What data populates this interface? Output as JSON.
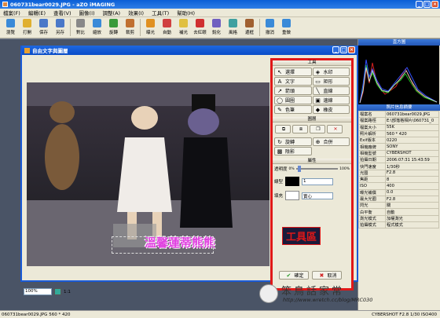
{
  "window": {
    "title": "060731bear0029.JPG - aZO iMAGING"
  },
  "menu": [
    "檔案(F)",
    "編輯(E)",
    "查看(V)",
    "圖像(I)",
    "調整(A)",
    "效果(I)",
    "工具(T)",
    "幫助(H)"
  ],
  "toolbar": [
    {
      "label": "瀏覽",
      "icon": "browse-icon"
    },
    {
      "label": "打開",
      "icon": "open-icon"
    },
    {
      "label": "保存",
      "icon": "save-icon"
    },
    {
      "label": "另存",
      "icon": "save-as-icon"
    },
    {
      "label": "對比",
      "icon": "compare-icon"
    },
    {
      "label": "縮放",
      "icon": "zoom-icon"
    },
    {
      "label": "旋轉",
      "icon": "rotate-icon"
    },
    {
      "label": "裁剪",
      "icon": "crop-icon"
    },
    {
      "label": "曝光",
      "icon": "exposure-icon"
    },
    {
      "label": "自動",
      "icon": "auto-icon"
    },
    {
      "label": "補光",
      "icon": "fill-light-icon"
    },
    {
      "label": "去紅眼",
      "icon": "red-eye-icon"
    },
    {
      "label": "銳化",
      "icon": "sharpen-icon"
    },
    {
      "label": "風格",
      "icon": "style-icon"
    },
    {
      "label": "邊框",
      "icon": "frame-icon"
    },
    {
      "label": "撤消",
      "icon": "undo-icon"
    },
    {
      "label": "重做",
      "icon": "redo-icon"
    }
  ],
  "histogram_panel": {
    "title": "直方圖"
  },
  "exif_panel": {
    "title": "照片信息摘要",
    "rows": [
      [
        "檔案名",
        "060731bear0029.JPG"
      ],
      [
        "檔案路徑",
        "E:\\部落格相片\\060731_0"
      ],
      [
        "檔案大小",
        "55K"
      ],
      [
        "照片解析",
        "560 * 420"
      ],
      [
        "Exif版本",
        "0220"
      ],
      [
        "相機廠牌",
        "SONY"
      ],
      [
        "相機型號",
        "CYBERSHOT"
      ],
      [
        "拍攝日期",
        "2006:07:31 15:43:59"
      ],
      [
        "快門速度",
        "1/30秒"
      ],
      [
        "光圈",
        "F2.8"
      ],
      [
        "焦距",
        "8"
      ],
      [
        "ISO",
        "400"
      ],
      [
        "曝光補償",
        "0.0"
      ],
      [
        "最大光圈",
        "F2.8"
      ],
      [
        "閃光",
        "關"
      ],
      [
        "白平衡",
        "自動"
      ],
      [
        "測光模式",
        "加權測光"
      ],
      [
        "拍攝模式",
        "程式模式"
      ]
    ]
  },
  "dialog": {
    "title": "自由文字與圖層",
    "zoom_value": "100%",
    "zoom_ratio": "1:1",
    "ok_label": "確定",
    "cancel_label": "取消"
  },
  "image_caption": "溫馨蓮蒂熊熊",
  "tools": {
    "group1_title": "工具",
    "buttons": [
      {
        "label": "選擇",
        "glyph": "↖"
      },
      {
        "label": "水印",
        "glyph": "◈"
      },
      {
        "label": "文字",
        "glyph": "A"
      },
      {
        "label": "矩形",
        "glyph": "▭"
      },
      {
        "label": "箭頭",
        "glyph": "↗"
      },
      {
        "label": "直線",
        "glyph": "╲"
      },
      {
        "label": "圓圈",
        "glyph": "◯"
      },
      {
        "label": "邊線",
        "glyph": "▣"
      },
      {
        "label": "色筆",
        "glyph": "✎"
      },
      {
        "label": "橡皮",
        "glyph": "◆"
      }
    ],
    "group2_title": "圖層",
    "rotate_label": "旋轉",
    "merge_label": "合併",
    "shadow_label": "陰影",
    "group3_title": "屬性",
    "opacity_label": "透明度",
    "opacity_min": "0%",
    "opacity_max": "100%",
    "line_label": "線型",
    "line_width": "1",
    "fill_label": "填充",
    "fill_value": "實心"
  },
  "annotation_label": "工具區",
  "watermark": {
    "line1": "笨鳥話家常",
    "line2": "http://www.wretch.cc/blog/MRC030"
  },
  "status": {
    "left": "060731bear0029.JPG  560 * 420",
    "right": "CYBERSHOT F2.8 1/30 ISO400"
  },
  "colors": {
    "accent_blue": "#1a5ad6",
    "annotation_red": "#e01818",
    "caption_magenta": "#e040e0"
  }
}
